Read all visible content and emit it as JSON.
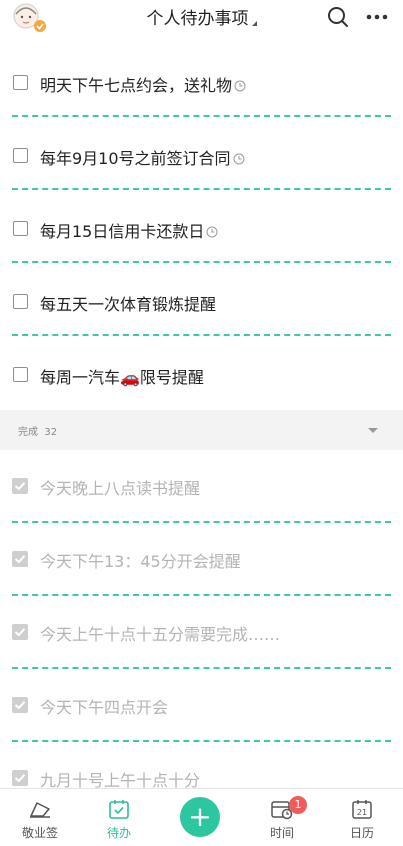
{
  "header": {
    "title": "个人待办事项",
    "icons": {
      "avatar": "avatar-with-badge",
      "search": "search-icon",
      "more": "more-dots-icon"
    }
  },
  "todo_items": [
    {
      "text": "明天下午七点约会，送礼物",
      "has_reminder": true
    },
    {
      "text": "每年9月10号之前签订合同",
      "has_reminder": true
    },
    {
      "text": "每月15日信用卡还款日",
      "has_reminder": true
    },
    {
      "text": "每五天一次体育锻炼提醒",
      "has_reminder": false
    },
    {
      "text": "每周一汽车🚗限号提醒",
      "has_reminder": false
    }
  ],
  "completed_section": {
    "label": "完成",
    "count": "32"
  },
  "completed_items": [
    {
      "text": "今天晚上八点读书提醒"
    },
    {
      "text": "今天下午13：45分开会提醒"
    },
    {
      "text": "今天上午十点十五分需要完成……"
    },
    {
      "text": "今天下午四点开会"
    },
    {
      "text": "九月十号上午十点十分"
    }
  ],
  "bottom_nav": {
    "items": [
      {
        "label": "敬业签"
      },
      {
        "label": "待办"
      },
      {
        "label": "时间",
        "badge": "1"
      },
      {
        "label": "日历",
        "day": "21"
      }
    ],
    "active": "待办"
  },
  "colors": {
    "accent": "#2cc6a0",
    "divider": "#3cc9a9",
    "badge": "#f35b5b",
    "completed_text": "#b4b4b4"
  }
}
